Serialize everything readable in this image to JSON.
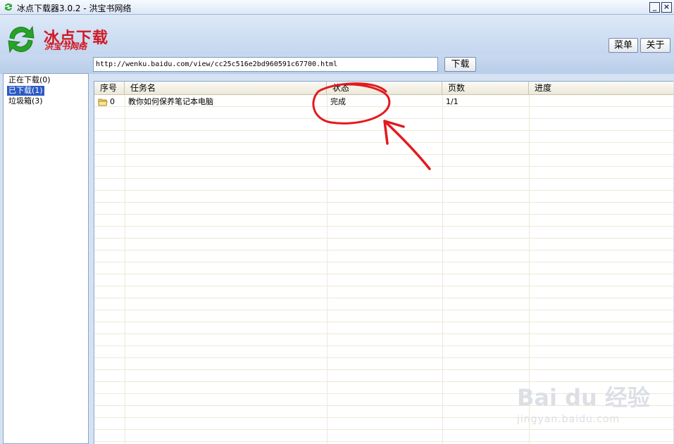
{
  "window": {
    "title": "冰点下载器3.0.2 - 洪宝书网络",
    "minimize_label": "_",
    "close_label": "×"
  },
  "header": {
    "brand": "冰点下载",
    "brand_sub": "洪宝书网络",
    "menu_label": "菜单",
    "about_label": "关于"
  },
  "toolbar": {
    "url_value": "http://wenku.baidu.com/view/cc25c516e2bd960591c67700.html",
    "download_label": "下载"
  },
  "sidebar": {
    "items": [
      {
        "label": "正在下载(0)",
        "selected": false
      },
      {
        "label": "已下载(1)",
        "selected": true
      },
      {
        "label": "垃圾箱(3)",
        "selected": false
      }
    ]
  },
  "list": {
    "columns": [
      "序号",
      "任务名",
      "状态",
      "页数",
      "进度"
    ],
    "rows": [
      {
        "index": "0",
        "name": "教你如何保养笔记本电脑",
        "status": "完成",
        "pages": "1/1",
        "progress": ""
      }
    ]
  },
  "watermark": {
    "logo": "Bai du 经验",
    "url": "jingyan.baidu.com"
  },
  "colors": {
    "brand": "#d01a24",
    "selection": "#2b59c3",
    "annotation": "#e3191f"
  },
  "icons": [
    "refresh-logo-icon",
    "folder-icon",
    "minimize-icon",
    "close-icon"
  ]
}
